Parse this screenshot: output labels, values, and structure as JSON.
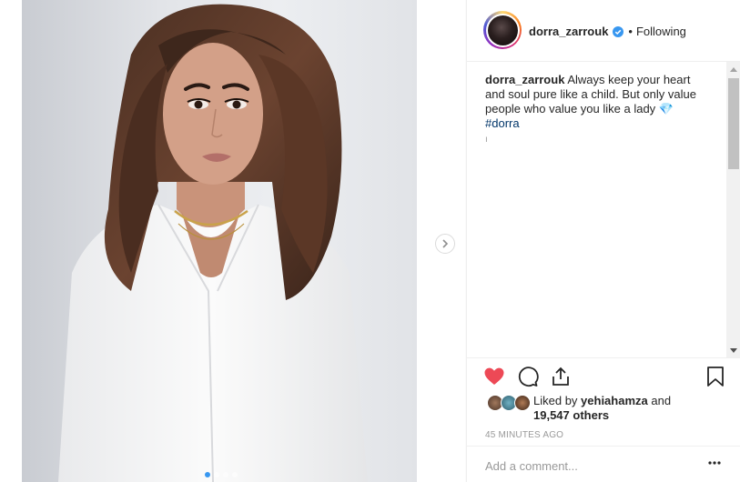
{
  "post": {
    "username": "dorra_zarrouk",
    "separator": "•",
    "follow_status": "Following",
    "verified": true,
    "caption": {
      "username": "dorra_zarrouk",
      "text": "Always keep your heart and soul pure like a child. But only value people who value you like a lady 💎",
      "hashtag": "#dorra",
      "mark": "ı"
    },
    "likes": {
      "prefix": "Liked by",
      "user": "yehiahamza",
      "and": "and",
      "others": "19,547 others"
    },
    "time": "45 MINUTES AGO",
    "comment_placeholder": "Add a comment...",
    "carousel": {
      "slides": 4,
      "current": 1
    }
  },
  "icons": {
    "like": "heart-filled-icon",
    "comment": "comment-bubble-icon",
    "share": "share-icon",
    "save": "bookmark-icon",
    "next": "chevron-right-icon",
    "more": "more-options-icon",
    "verified": "verified-badge-icon"
  },
  "colors": {
    "like": "#ed4956",
    "verified": "#3897f0",
    "hashtag": "#003569",
    "muted": "#999999"
  }
}
